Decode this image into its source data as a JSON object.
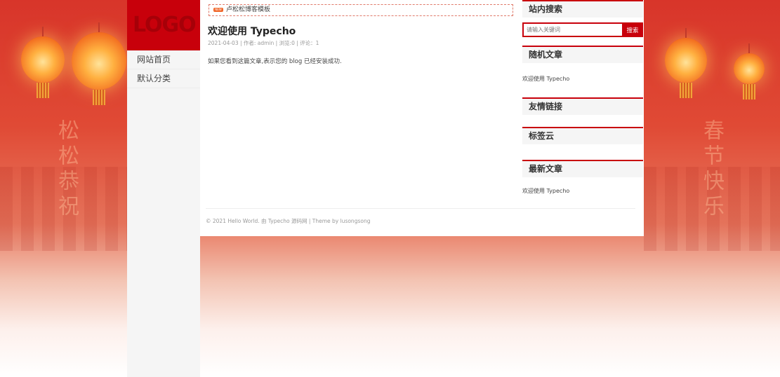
{
  "deco": {
    "left_text": "松松恭祝",
    "right_text": "春节快乐"
  },
  "site": {
    "logo": "LOGO"
  },
  "nav": {
    "items": [
      {
        "label": "网站首页"
      },
      {
        "label": "默认分类"
      }
    ]
  },
  "notice": {
    "badge": "NEW",
    "text": "卢松松博客模板"
  },
  "post": {
    "title": "欢迎使用 Typecho",
    "meta": "2021-04-03 | 作者: admin | 浏览:0 | 评论：1",
    "body": "如果您看到这篇文章,表示您的 blog 已经安装成功."
  },
  "footer": {
    "text": "© 2021 Hello World. 由 Typecho 源码网 | Theme by lusongsong"
  },
  "sidebar": {
    "search": {
      "title": "站内搜索",
      "placeholder": "请输入关键词",
      "button": "搜索"
    },
    "random": {
      "title": "随机文章",
      "items": [
        "欢迎使用 Typecho"
      ]
    },
    "links": {
      "title": "友情链接"
    },
    "tags": {
      "title": "标签云"
    },
    "latest": {
      "title": "最新文章",
      "items": [
        "欢迎使用 Typecho"
      ]
    }
  },
  "colors": {
    "brand": "#c8000b",
    "accent": "#f0672b"
  }
}
